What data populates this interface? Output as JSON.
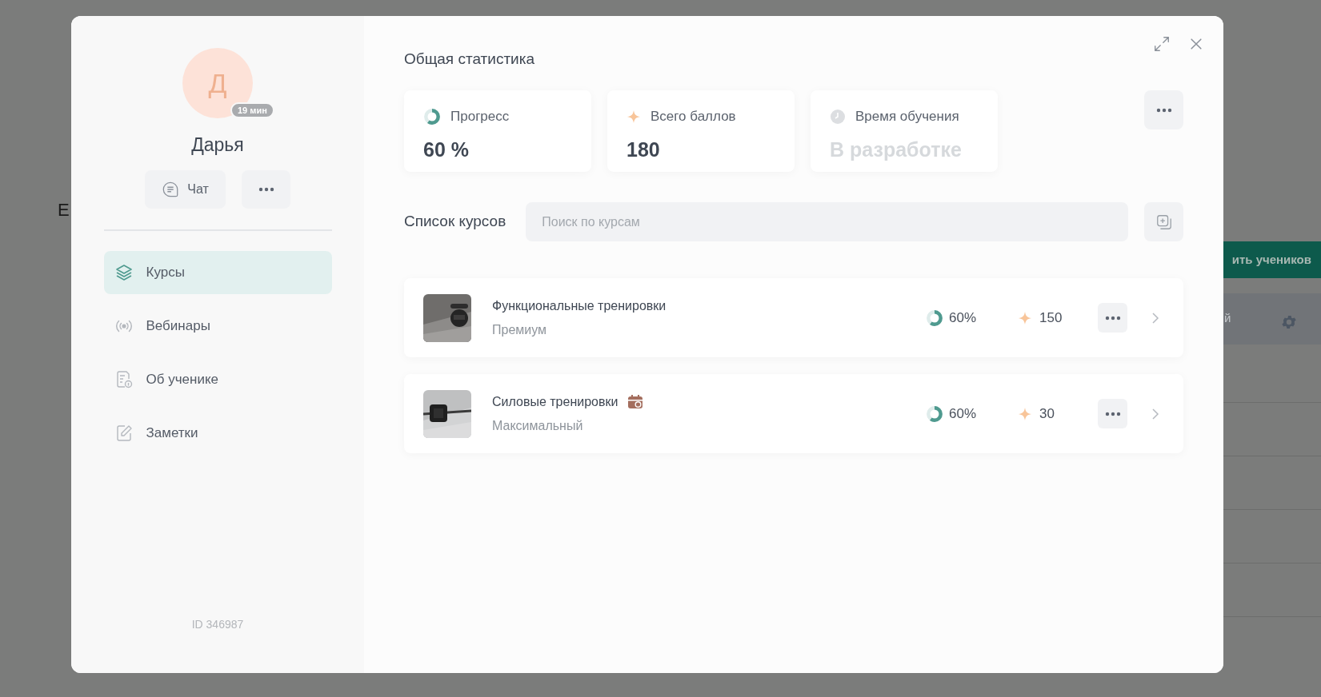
{
  "background": {
    "heading_fragment": "Е",
    "button_fragment": "ить учеников",
    "column_fragment": "й"
  },
  "profile": {
    "initial": "Д",
    "online_badge": "19 мин",
    "name": "Дарья",
    "chat_button": "Чат",
    "id_label": "ID 346987"
  },
  "nav": [
    {
      "label": "Курсы",
      "kind": "courses",
      "selected": true
    },
    {
      "label": "Вебинары",
      "kind": "webinars",
      "selected": false
    },
    {
      "label": "Об ученике",
      "kind": "about",
      "selected": false
    },
    {
      "label": "Заметки",
      "kind": "notes",
      "selected": false
    }
  ],
  "stats_title": "Общая статистика",
  "stats": [
    {
      "kind": "progress",
      "label": "Прогресс",
      "value": "60 %",
      "level": 0.6,
      "disabled": false
    },
    {
      "kind": "points",
      "label": "Всего баллов",
      "value": "180",
      "disabled": false
    },
    {
      "kind": "time",
      "label": "Время обучения",
      "value": "В разработке",
      "disabled": true
    }
  ],
  "courses_title": "Список курсов",
  "search": {
    "placeholder": "Поиск по курсам"
  },
  "courses": [
    {
      "title": "Функциональные тренировки",
      "plan": "Премиум",
      "scheduled": false,
      "progress": "60%",
      "level": 0.6,
      "points": "150"
    },
    {
      "title": "Силовые тренировки",
      "plan": "Максимальный",
      "scheduled": true,
      "progress": "60%",
      "level": 0.6,
      "points": "30"
    }
  ]
}
